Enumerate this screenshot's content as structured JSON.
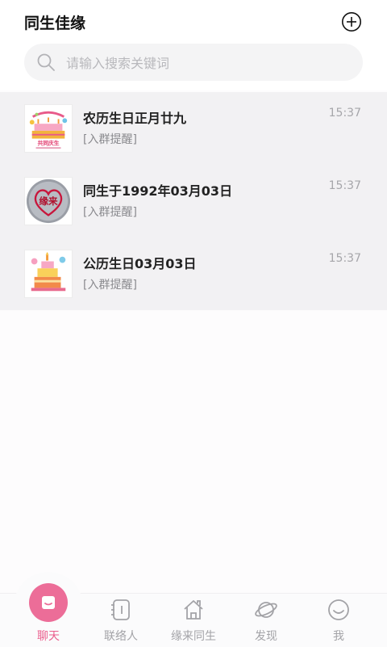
{
  "app": {
    "title": "同生佳缘"
  },
  "search": {
    "placeholder": "请输入搜索关键词",
    "value": ""
  },
  "icons": {
    "add": "add-circle-icon",
    "search": "search-icon"
  },
  "chats": [
    {
      "name": "农历生日正月廿九",
      "preview": "[入群提醒]",
      "time": "15:37",
      "avatar_icon": "birthday-cake-icon",
      "avatar_text": "共同庆生"
    },
    {
      "name": "同生于1992年03月03日",
      "preview": "[入群提醒]",
      "time": "15:37",
      "avatar_icon": "heart-logo-icon",
      "avatar_text": "缘来"
    },
    {
      "name": "公历生日03月03日",
      "preview": "[入群提醒]",
      "time": "15:37",
      "avatar_icon": "birthday-cake-icon"
    }
  ],
  "tabs": [
    {
      "label": "聊天",
      "icon": "chat-icon",
      "active": true
    },
    {
      "label": "联络人",
      "icon": "contacts-icon",
      "active": false
    },
    {
      "label": "缘来同生",
      "icon": "home-icon",
      "active": false
    },
    {
      "label": "发现",
      "icon": "planet-icon",
      "active": false
    },
    {
      "label": "我",
      "icon": "smiley-icon",
      "active": false
    }
  ],
  "colors": {
    "accent": "#ec6d98",
    "list_bg": "#f2f1f3",
    "muted_text": "#a3a3a7"
  }
}
